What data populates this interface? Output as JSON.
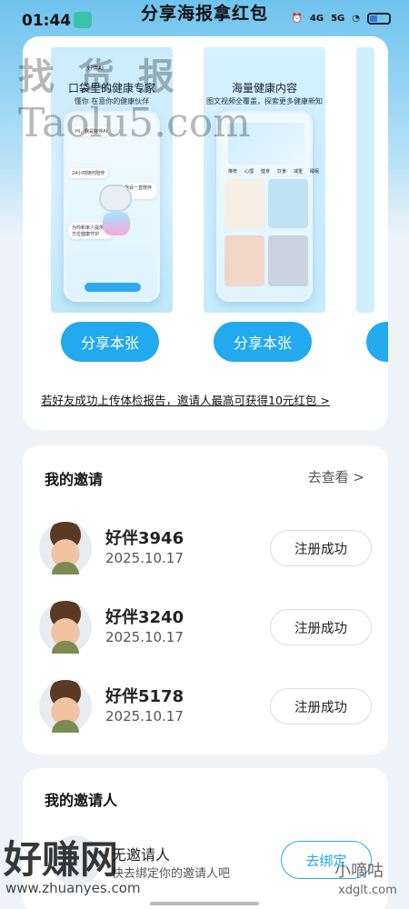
{
  "status_bar": {
    "time": "01:44",
    "network_1": "4G",
    "network_2": "5G"
  },
  "page": {
    "title": "分享海报拿红包"
  },
  "posters": [
    {
      "brand": "好伴AI",
      "headline": "口袋里的健康专家",
      "subtitle": "懂你 在意你的健康伙伴",
      "bubbles": [
        "Hi，我是好伴AI",
        "24小时随时陪伴",
        "我会一直陪伴你",
        "为你和家人提供全方位健康守护"
      ],
      "share_label": "分享本张"
    },
    {
      "headline": "海量健康内容",
      "subtitle": "图文视频全覆盖，探索更多健康新知",
      "tabs": [
        "推荐",
        "心理",
        "健身",
        "饮食",
        "减重",
        "睡眠"
      ],
      "share_label": "分享本张"
    },
    {
      "share_label": ""
    }
  ],
  "reward_notice": "若好友成功上传体检报告，邀请人最高可获得10元红包 >",
  "invites": {
    "title": "我的邀请",
    "view_label": "去查看 >",
    "items": [
      {
        "name": "好伴3946",
        "date": "2025.10.17",
        "status": "注册成功"
      },
      {
        "name": "好伴3240",
        "date": "2025.10.17",
        "status": "注册成功"
      },
      {
        "name": "好伴5178",
        "date": "2025.10.17",
        "status": "注册成功"
      }
    ]
  },
  "inviter": {
    "title": "我的邀请人",
    "name": "无邀请人",
    "hint": "快去绑定你的邀请人吧",
    "bind_label": "去绑定"
  },
  "watermarks": {
    "top_1": "找 货 报",
    "top_2": "Taolu5.com",
    "bottom_left": "好赚网",
    "bottom_left_url": "www.zhuanyes.com",
    "bottom_right": "小嘀咕",
    "bottom_right_url": "xdglt.com"
  },
  "colors": {
    "accent": "#22a9ee",
    "background": "#eef3f8",
    "header_gradient": "#6fc3ee"
  }
}
